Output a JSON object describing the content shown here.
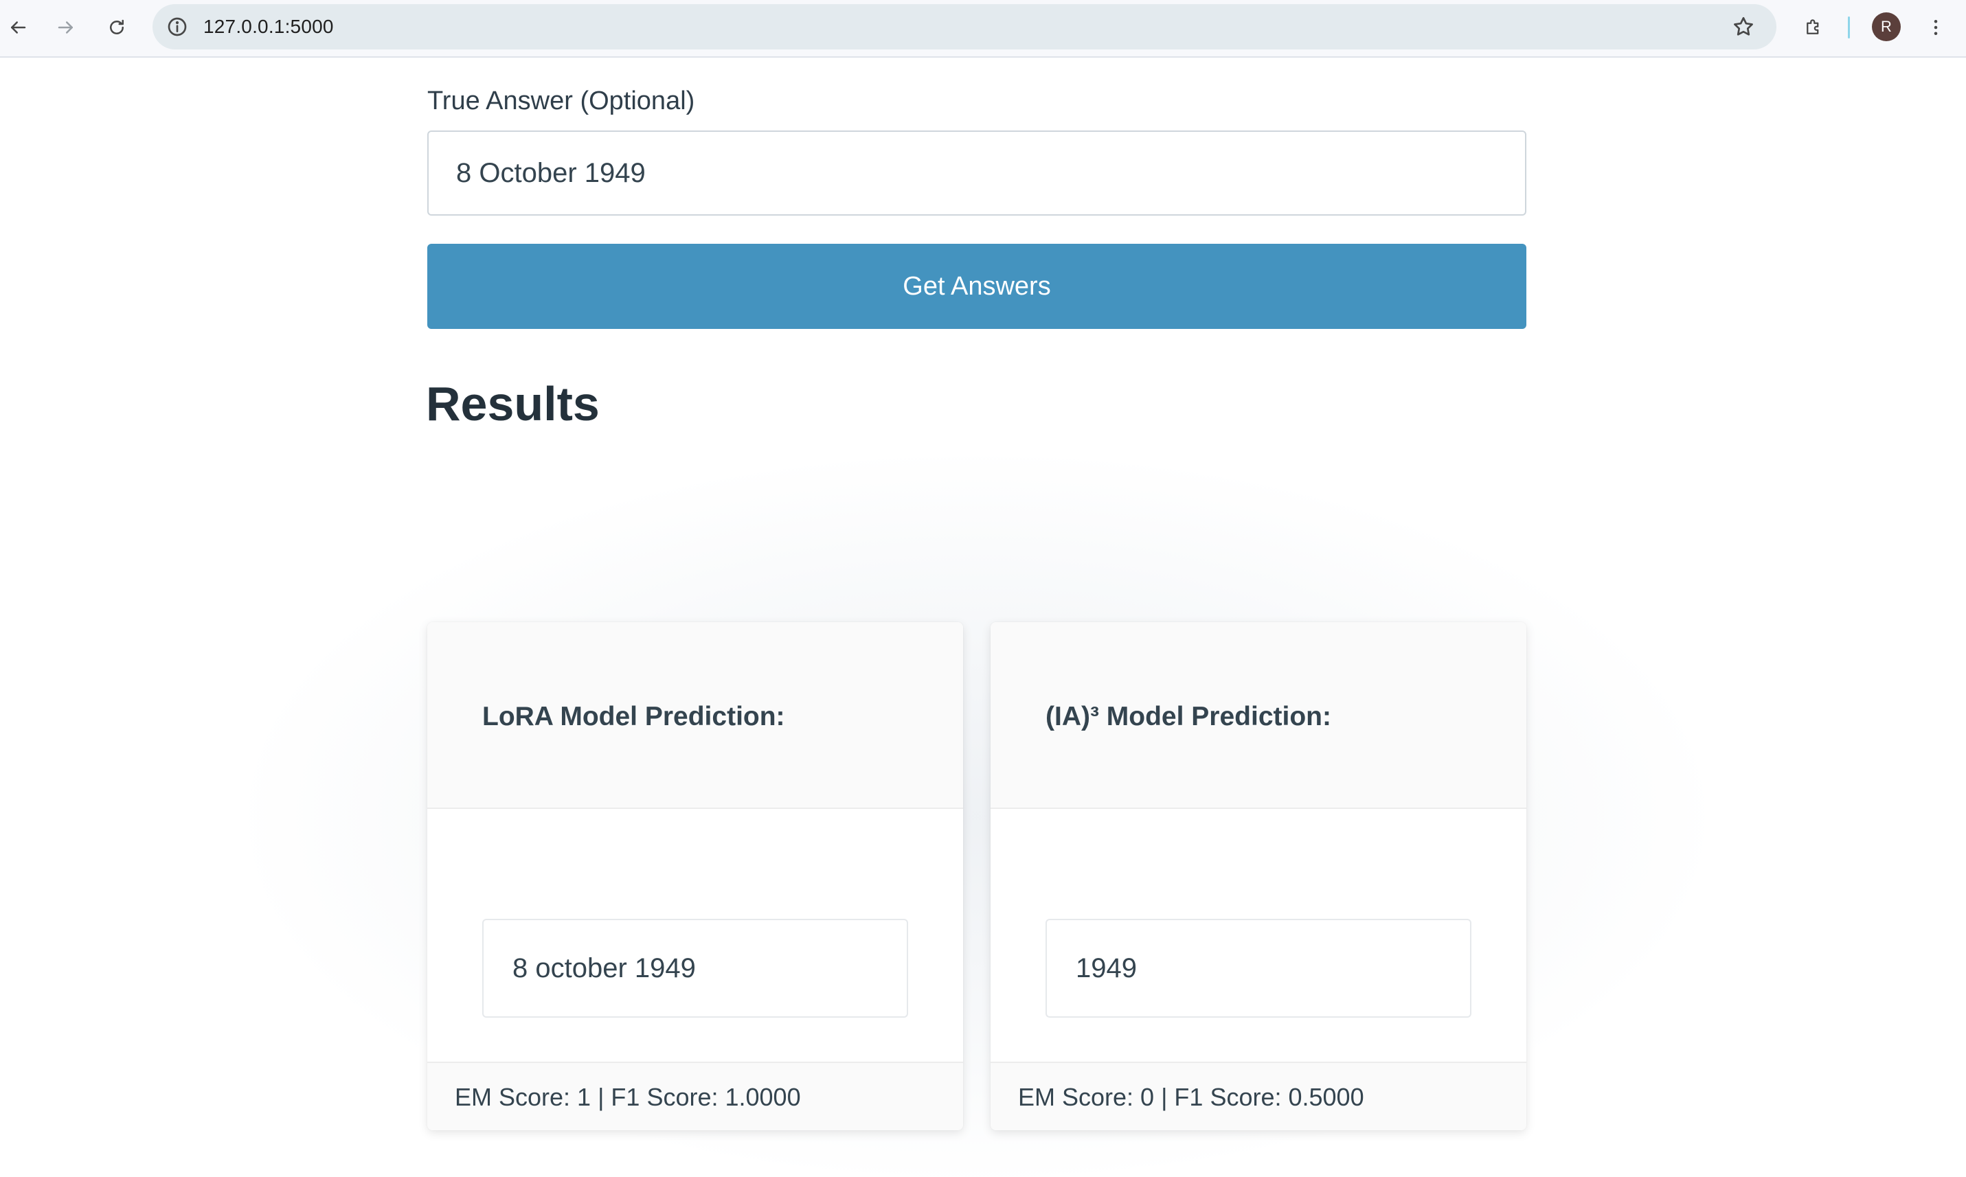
{
  "browser": {
    "url": "127.0.0.1:5000",
    "avatar_letter": "R",
    "icons": {
      "back": "arrow-left-icon",
      "forward": "arrow-right-icon",
      "reload": "reload-icon",
      "site_info": "info-icon",
      "bookmark": "star-icon",
      "extensions": "puzzle-icon",
      "menu": "kebab-menu-icon"
    }
  },
  "form": {
    "true_answer_label": "True Answer (Optional)",
    "true_answer_value": "8 October 1949",
    "submit_label": "Get Answers"
  },
  "results": {
    "heading": "Results",
    "cards": [
      {
        "title": "LoRA Model Prediction:",
        "prediction": "8 october 1949",
        "scores": "EM Score: 1 | F1 Score: 1.0000"
      },
      {
        "title": "(IA)³ Model Prediction:",
        "prediction": "1949",
        "scores": "EM Score: 0 | F1 Score: 0.5000"
      }
    ]
  },
  "colors": {
    "primary_button": "#4493bf",
    "text": "#34444f",
    "omnibox": "#e3eaee"
  }
}
